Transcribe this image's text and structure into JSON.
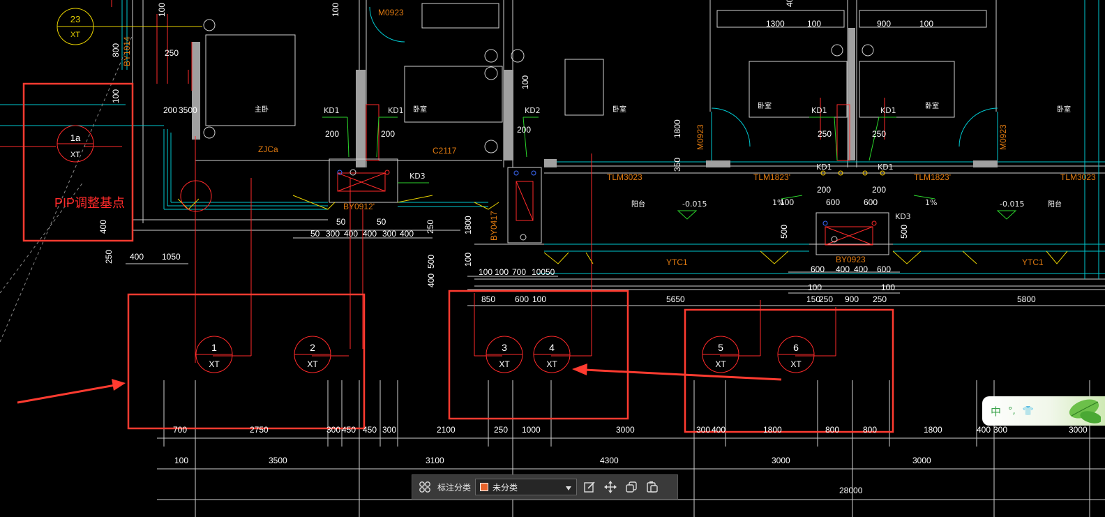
{
  "drawing": {
    "title_bubble": {
      "number": "23",
      "code": "XT"
    },
    "room_labels": [
      "主卧",
      "卧室",
      "卧室",
      "卧室",
      "卧室",
      "卧室",
      "卧室",
      "阳台",
      "阳台"
    ],
    "labels": {
      "m0923_top": "M0923",
      "m0923_left": "M0923",
      "m0923_right": "M0923",
      "c2117": "C2117",
      "zjca": "ZJCa",
      "by1014": "BY1014",
      "by0912": "BY0912'",
      "by0417": "BY0417",
      "by0923": "BY0923",
      "tlm3023_a": "TLM3023",
      "tlm3023_b": "TLM3023",
      "tlm1823_a": "TLM1823'",
      "tlm1823_b": "TLM1823'",
      "ytc1_a": "YTC1",
      "ytc1_b": "YTC1",
      "pip_text": "PIP调整基点",
      "level_a": "-0.015",
      "level_b": "-0.015",
      "slope_a": "1%",
      "slope_b": "1%",
      "slope_c": "1%",
      "kd1": "KD1",
      "kd2": "KD2",
      "kd3": "KD3"
    },
    "bubbles": [
      {
        "number": "1a",
        "code": "XT"
      },
      {
        "number": "1",
        "code": "XT"
      },
      {
        "number": "2",
        "code": "XT"
      },
      {
        "number": "3",
        "code": "XT"
      },
      {
        "number": "4",
        "code": "XT"
      },
      {
        "number": "5",
        "code": "XT"
      },
      {
        "number": "6",
        "code": "XT"
      }
    ],
    "dims_row1": [
      "700",
      "2750",
      "300",
      "450",
      "450",
      "300",
      "2100",
      "250",
      "1000",
      "3000",
      "300",
      "400",
      "1800",
      "800",
      "800",
      "1800",
      "400",
      "300",
      "3000"
    ],
    "dims_row2": [
      "100",
      "3500",
      "3100",
      "4300",
      "3000",
      "3000"
    ],
    "dims_total": "28000",
    "dims_mid": [
      "850",
      "600",
      "100",
      "5650",
      "150",
      "250",
      "900",
      "250",
      "5800",
      "100",
      "100"
    ],
    "dims_misc": [
      "400",
      "1050",
      "250",
      "50",
      "300",
      "400",
      "400",
      "300",
      "50",
      "50",
      "250",
      "100",
      "100",
      "700",
      "100",
      "50",
      "500",
      "400",
      "1800",
      "100",
      "600",
      "400",
      "400",
      "600",
      "100",
      "600",
      "600",
      "500",
      "500",
      "200",
      "200",
      "200",
      "250",
      "250",
      "200",
      "200",
      "100",
      "100",
      "1300",
      "1300",
      "100",
      "900",
      "100",
      "1800",
      "800",
      "350",
      "250",
      "200",
      "3500",
      "100",
      "100",
      "100",
      "400",
      "100"
    ]
  },
  "toolbar": {
    "category_label": "标注分类",
    "selected_value": "未分类",
    "swatch_color": "#e8622a"
  },
  "ime": {
    "mode": "中",
    "punct": "°,",
    "skin": "👕"
  }
}
